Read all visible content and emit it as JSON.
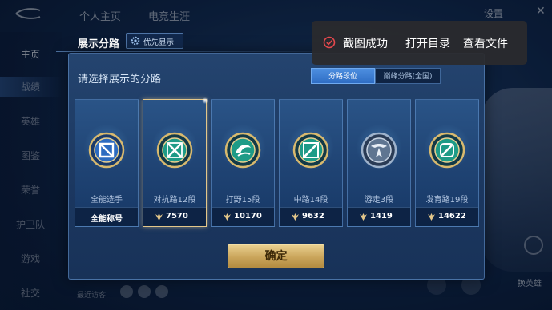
{
  "background": {
    "tabs": [
      "个人主页",
      "电竞生涯"
    ],
    "settings_label": "设置",
    "sidebar": [
      "主页",
      "战绩",
      "英雄",
      "图鉴",
      "荣誉",
      "护卫队",
      "游戏",
      "社交"
    ],
    "switch_hero_label": "换英雄",
    "bottom_text": "最近访客"
  },
  "dialog": {
    "title": "展示分路",
    "priority_button": "优先显示",
    "prompt": "请选择展示的分路",
    "segments": [
      "分路段位",
      "巅峰分路(全国)"
    ],
    "active_segment": "分路段位",
    "cards": [
      {
        "role": "全能选手",
        "bottom_text": "全能称号",
        "emblem": "all-rounder-emblem-icon",
        "selected": false
      },
      {
        "role": "对抗路12段",
        "power": "7570",
        "emblem": "clash-lane-emblem-icon",
        "selected": true
      },
      {
        "role": "打野15段",
        "power": "10170",
        "emblem": "jungle-emblem-icon",
        "selected": false
      },
      {
        "role": "中路14段",
        "power": "9632",
        "emblem": "mid-lane-emblem-icon",
        "selected": false
      },
      {
        "role": "游走3段",
        "power": "1419",
        "emblem": "roam-emblem-icon",
        "selected": false
      },
      {
        "role": "发育路19段",
        "power": "14622",
        "emblem": "farm-lane-emblem-icon",
        "selected": false
      }
    ],
    "confirm_label": "确定"
  },
  "toast": {
    "message": "截图成功",
    "open_folder": "打开目录",
    "view_file": "查看文件"
  },
  "colors": {
    "gold": "#e3c78a",
    "accent_blue": "#4d8fe0",
    "toast_icon_red": "#e5484d"
  }
}
